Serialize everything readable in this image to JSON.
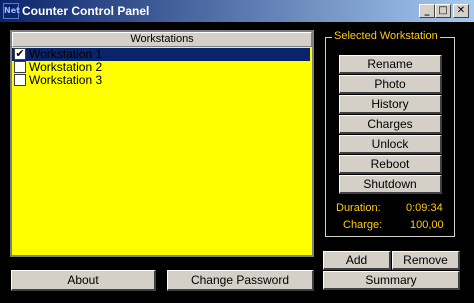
{
  "window": {
    "title": "Counter Control Panel",
    "icon_text": "Net"
  },
  "titlebar_buttons": {
    "minimize": "_",
    "maximize": "□",
    "close": "✕"
  },
  "workstations": {
    "header": "Workstations",
    "items": [
      {
        "label": "Workstation 1",
        "checked": true,
        "selected": true
      },
      {
        "label": "Workstation 2",
        "checked": false,
        "selected": false
      },
      {
        "label": "Workstation 3",
        "checked": false,
        "selected": false
      }
    ]
  },
  "selected_workstation": {
    "title": "Selected Workstation",
    "buttons": {
      "rename": "Rename",
      "photo": "Photo",
      "history": "History",
      "charges": "Charges",
      "unlock": "Unlock",
      "reboot": "Reboot",
      "shutdown": "Shutdown"
    },
    "duration_label": "Duration:",
    "duration_value": "0:09:34",
    "charge_label": "Charge:",
    "charge_value": "100,00"
  },
  "bottom": {
    "about": "About",
    "change_password": "Change Password",
    "add": "Add",
    "remove": "Remove",
    "summary": "Summary"
  },
  "check_glyph": "✔",
  "colors": {
    "list_background": "#ffff00",
    "accent_text": "#ffcc00",
    "titlebar_start": "#0a246a"
  }
}
